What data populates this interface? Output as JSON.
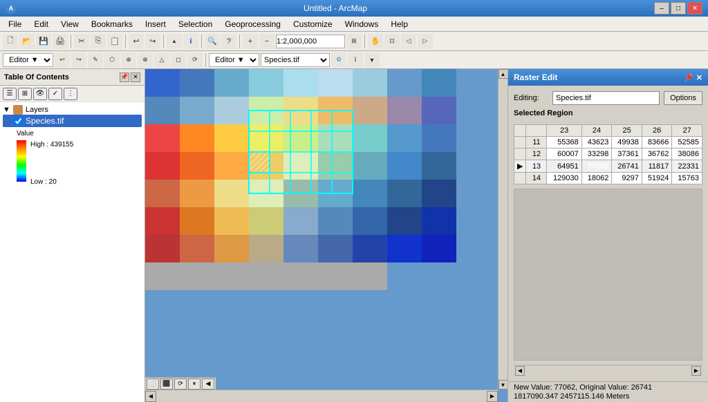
{
  "titleBar": {
    "title": "Untitled - ArcMap",
    "minimizeLabel": "–",
    "restoreLabel": "□",
    "closeLabel": "✕"
  },
  "menuBar": {
    "items": [
      "File",
      "Edit",
      "View",
      "Bookmarks",
      "Insert",
      "Selection",
      "Geoprocessing",
      "Customize",
      "Windows",
      "Help"
    ]
  },
  "toolbar1": {
    "zoomValue": "1:2,000,000"
  },
  "editorBar": {
    "editorLabel": "Editor ▼",
    "speciesLabel": "Species.tif"
  },
  "toc": {
    "title": "Table Of Contents",
    "layersLabel": "Layers",
    "layerName": "Species.tif",
    "valueLabel": "Value",
    "highLabel": "High : 439155",
    "lowLabel": "Low : 20"
  },
  "rasterEdit": {
    "title": "Raster Edit",
    "pinLabel": "📌",
    "closeLabel": "✕",
    "editingLabel": "Editing:",
    "editingValue": "Species.tif",
    "optionsLabel": "Options",
    "selectedRegionLabel": "Selected Region",
    "colHeaders": [
      "23",
      "24",
      "25",
      "26",
      "27"
    ],
    "rows": [
      {
        "rowNum": "11",
        "values": [
          "55368",
          "43623",
          "49938",
          "83666",
          "52585"
        ],
        "active": false,
        "arrowCol": ""
      },
      {
        "rowNum": "12",
        "values": [
          "60007",
          "33298",
          "37361",
          "36762",
          "38086"
        ],
        "active": false,
        "arrowCol": ""
      },
      {
        "rowNum": "13",
        "values": [
          "64951",
          "77062",
          "26741",
          "11817",
          "22331"
        ],
        "active": true,
        "arrowCol": "▶",
        "highlightCol": 1
      },
      {
        "rowNum": "14",
        "values": [
          "129030",
          "18062",
          "9297",
          "51924",
          "15763"
        ],
        "active": false,
        "arrowCol": ""
      }
    ],
    "statusLine1": "New Value: 77062, Original Value: 26741",
    "statusLine2": "1817090.347  2457115.146 Meters"
  }
}
